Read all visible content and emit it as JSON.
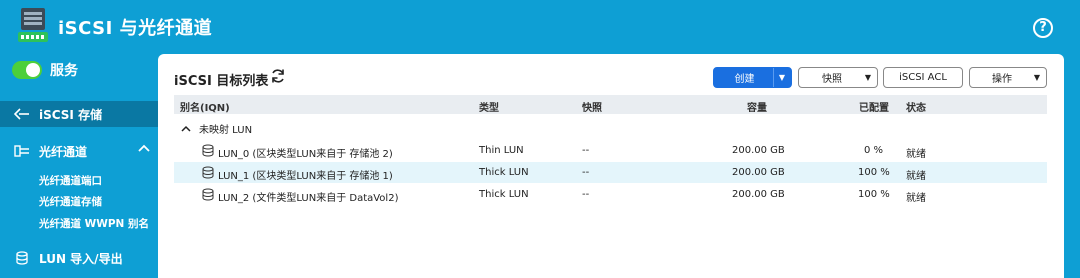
{
  "header": {
    "title": "iSCSI 与光纤通道",
    "help_label": "?"
  },
  "sidebar": {
    "service": {
      "label": "服务",
      "enabled": true
    },
    "items": [
      {
        "label": "iSCSI 存储",
        "icon": "iscsi-icon",
        "active": true
      },
      {
        "label": "光纤通道",
        "icon": "fibre-channel-icon",
        "expanded": true
      },
      {
        "label": "LUN 导入/导出",
        "icon": "lun-import-export-icon"
      }
    ],
    "sub_items": [
      {
        "label": "光纤通道端口"
      },
      {
        "label": "光纤通道存储"
      },
      {
        "label": "光纤通道 WWPN 别名"
      }
    ]
  },
  "panel": {
    "title": "iSCSI 目标列表",
    "buttons": {
      "create": "创建",
      "snapshot": "快照",
      "iscsi_acl": "iSCSI ACL",
      "action": "操作"
    }
  },
  "table": {
    "columns": {
      "alias": "别名(IQN)",
      "type": "类型",
      "snapshot": "快照",
      "capacity": "容量",
      "allocated": "已配置",
      "status": "状态"
    },
    "group": {
      "label": "未映射 LUN",
      "expanded": true
    },
    "rows": [
      {
        "name": "LUN_0 (区块类型LUN来自于 存储池 2)",
        "type": "Thin LUN",
        "snapshot": "--",
        "capacity": "200.00 GB",
        "allocated": "0 %",
        "status": "就绪",
        "highlighted": false
      },
      {
        "name": "LUN_1 (区块类型LUN来自于 存储池 1)",
        "type": "Thick LUN",
        "snapshot": "--",
        "capacity": "200.00 GB",
        "allocated": "100 %",
        "status": "就绪",
        "highlighted": true
      },
      {
        "name": "LUN_2 (文件类型LUN来自于 DataVol2)",
        "type": "Thick LUN",
        "snapshot": "--",
        "capacity": "200.00 GB",
        "allocated": "100 %",
        "status": "就绪",
        "highlighted": false
      }
    ]
  },
  "colors": {
    "background": "#0e9fd4",
    "sidebar_active": "#0a78a3",
    "toggle_on": "#4ccf3a",
    "primary_button": "#1a6fe0",
    "row_highlight": "#e4f5fb"
  }
}
